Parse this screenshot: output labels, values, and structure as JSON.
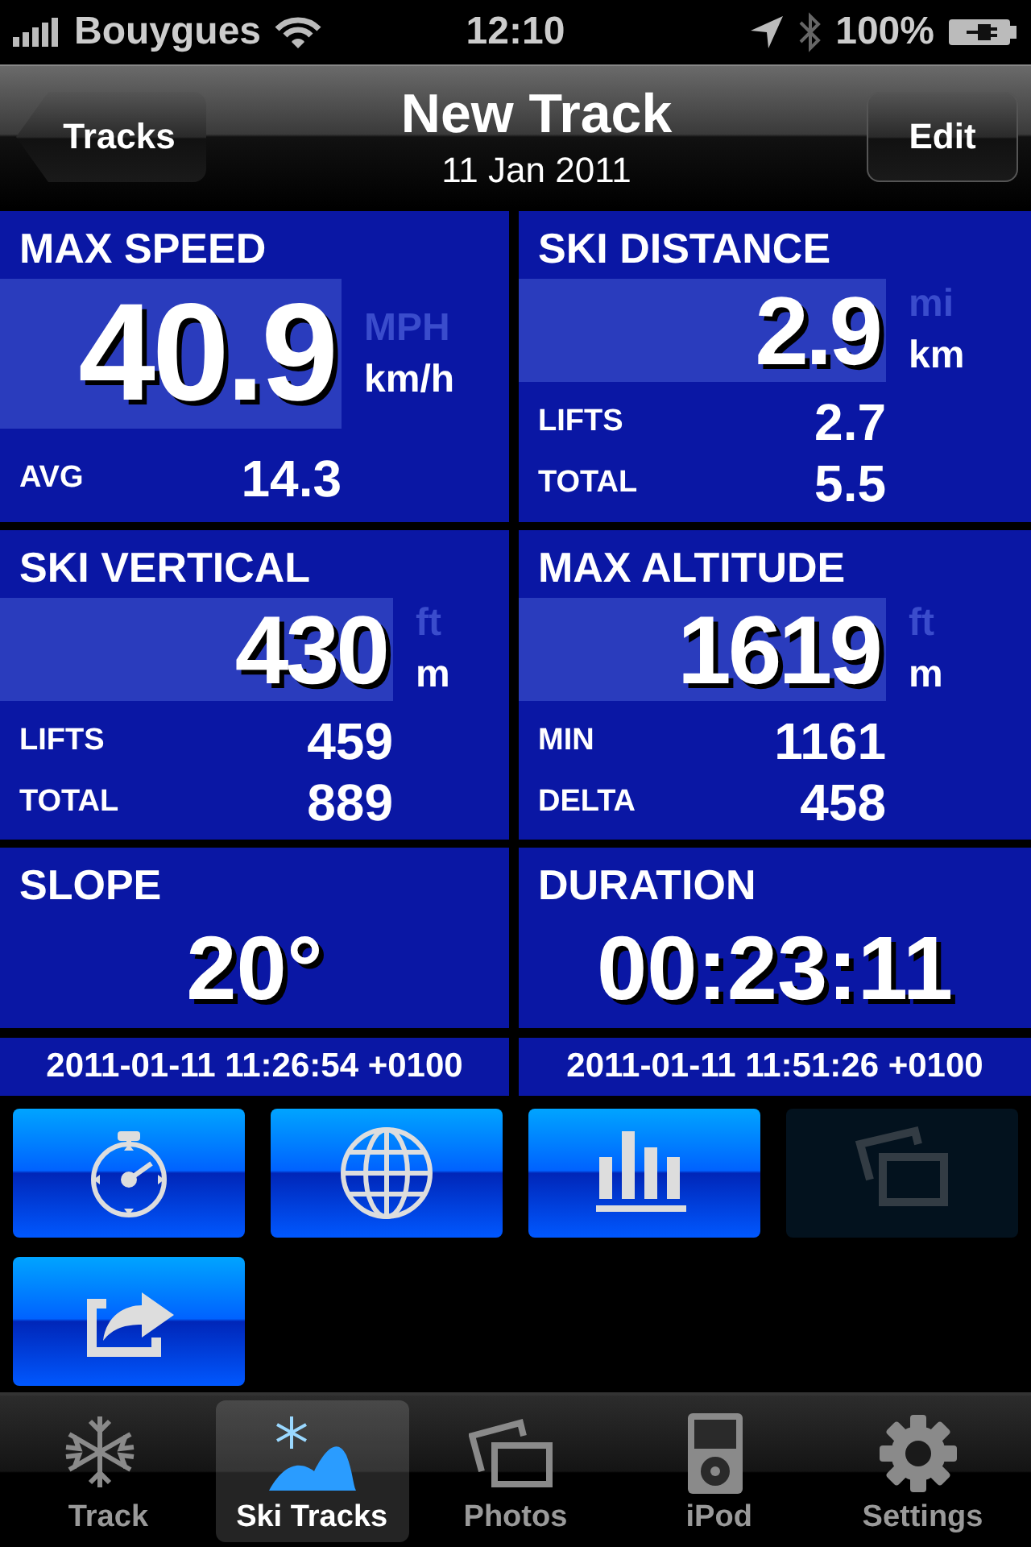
{
  "status_bar": {
    "carrier": "Bouygues",
    "time": "12:10",
    "battery": "100%"
  },
  "nav_bar": {
    "back": "Tracks",
    "title": "New Track",
    "subtitle": "11 Jan 2011",
    "action": "Edit"
  },
  "tiles": [
    {
      "kind": "large",
      "title": "MAX SPEED",
      "value": "40.9",
      "units": [
        {
          "label": "MPH",
          "selected": false
        },
        {
          "label": "km/h",
          "selected": true
        }
      ],
      "stats": [
        {
          "label": "AVG",
          "value": "14.3"
        }
      ]
    },
    {
      "kind": "medium",
      "title": "SKI DISTANCE",
      "value": "2.9",
      "units": [
        {
          "label": "mi",
          "selected": false
        },
        {
          "label": "km",
          "selected": true
        }
      ],
      "stats": [
        {
          "label": "LIFTS",
          "value": "2.7"
        },
        {
          "label": "TOTAL",
          "value": "5.5"
        }
      ]
    },
    {
      "kind": "medium",
      "title": "SKI VERTICAL",
      "value": "430",
      "units": [
        {
          "label": "ft",
          "selected": false
        },
        {
          "label": "m",
          "selected": true
        }
      ],
      "stats": [
        {
          "label": "LIFTS",
          "value": "459"
        },
        {
          "label": "TOTAL",
          "value": "889"
        }
      ]
    },
    {
      "kind": "medium",
      "title": "MAX ALTITUDE",
      "value": "1619",
      "units": [
        {
          "label": "ft",
          "selected": false
        },
        {
          "label": "m",
          "selected": true
        }
      ],
      "stats": [
        {
          "label": "MIN",
          "value": "1161"
        },
        {
          "label": "DELTA",
          "value": "458"
        }
      ]
    },
    {
      "kind": "simple",
      "title": "SLOPE",
      "value": "20°"
    },
    {
      "kind": "simple",
      "title": "DURATION",
      "value": "00:23:11"
    }
  ],
  "timestamps": [
    "2011-01-11 11:26:54 +0100",
    "2011-01-11 11:51:26 +0100"
  ],
  "buttons": [
    {
      "kind": "stopwatch",
      "disabled": false
    },
    {
      "kind": "globe",
      "disabled": false
    },
    {
      "kind": "chart",
      "disabled": false
    },
    {
      "kind": "photos",
      "disabled": true
    },
    {
      "kind": "share",
      "disabled": false
    }
  ],
  "tabs": [
    {
      "kind": "snowflake",
      "label": "Track",
      "selected": false
    },
    {
      "kind": "ski",
      "label": "Ski Tracks",
      "selected": true
    },
    {
      "kind": "photos",
      "label": "Photos",
      "selected": false
    },
    {
      "kind": "ipod",
      "label": "iPod",
      "selected": false
    },
    {
      "kind": "gear",
      "label": "Settings",
      "selected": false
    }
  ]
}
